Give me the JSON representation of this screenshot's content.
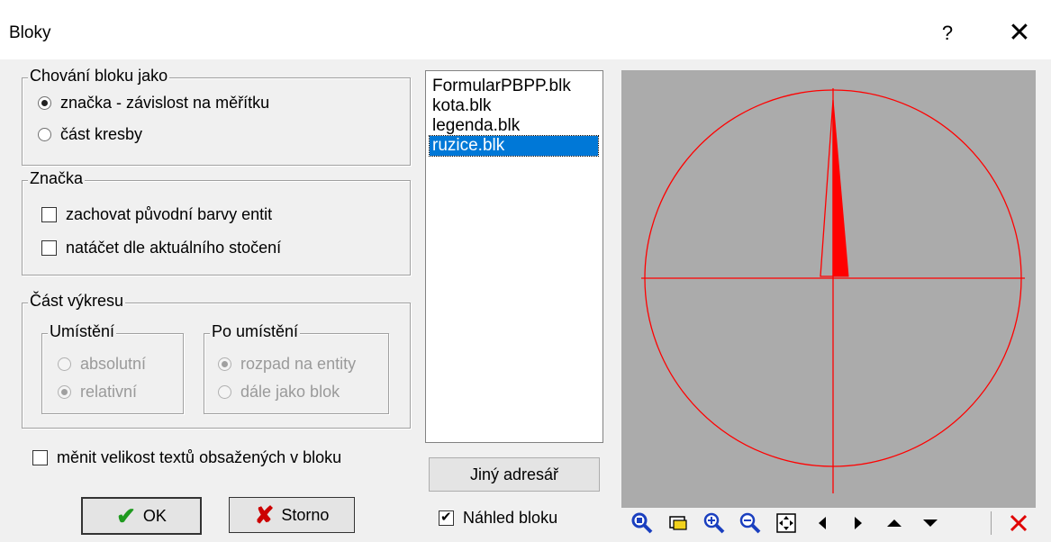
{
  "window": {
    "title": "Bloky",
    "help_glyph": "?",
    "close_glyph": "✕"
  },
  "behaviour": {
    "legend": "Chování bloku jako",
    "options": [
      "značka - závislost na měřítku",
      "část kresby"
    ]
  },
  "znacka": {
    "legend": "Značka",
    "options": [
      "zachovat původní barvy entit",
      "natáčet dle aktuálního stočení"
    ]
  },
  "cast": {
    "legend": "Část výkresu",
    "umisteni": {
      "legend": "Umístění",
      "options": [
        "absolutní",
        "relativní"
      ]
    },
    "po_umisteni": {
      "legend": "Po umístění",
      "options": [
        "rozpad na entity",
        "dále jako blok"
      ]
    }
  },
  "resize_texts": "měnit velikost textů obsažených v bloku",
  "buttons": {
    "ok": "OK",
    "cancel": "Storno",
    "other_dir": "Jiný adresář"
  },
  "files": [
    "FormularPBPP.blk",
    "kota.blk",
    "legenda.blk",
    "ruzice.blk"
  ],
  "preview_toggle": "Náhled bloku",
  "toolbar_icons": [
    "zoom-window-icon",
    "zoom-extents-icon",
    "zoom-in-icon",
    "zoom-out-icon",
    "fit-icon",
    "pan-left-icon",
    "pan-right-icon",
    "pan-up-icon",
    "pan-down-icon",
    "delete-icon"
  ],
  "colors": {
    "selection": "#0078d7",
    "preview_bg": "#ababab",
    "preview_stroke": "#ff0000"
  }
}
